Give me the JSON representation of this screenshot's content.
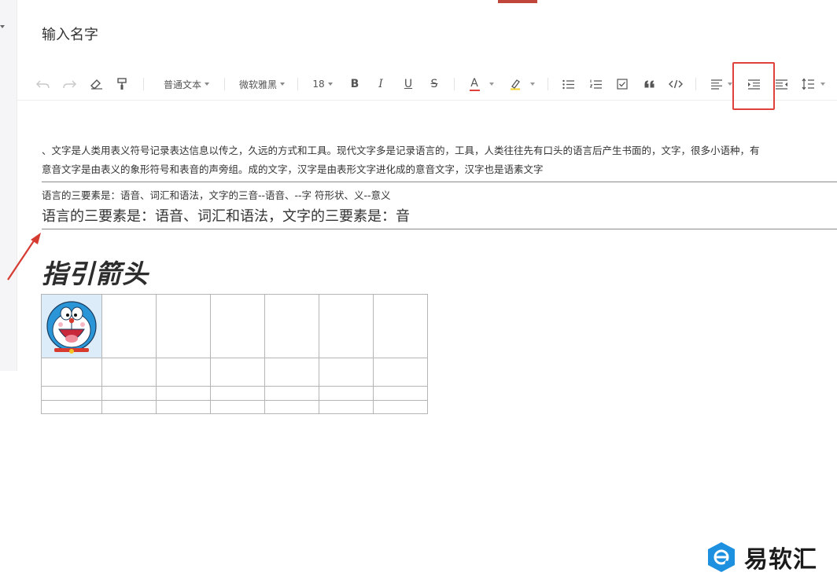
{
  "document": {
    "title": "输入名字"
  },
  "toolbar": {
    "paragraph_style": "普通文本",
    "font_family": "微软雅黑",
    "font_size": "18",
    "bold_label": "B",
    "italic_label": "I",
    "underline_label": "U",
    "strike_label": "S",
    "font_color_label": "A",
    "accent_color": "#e0413b"
  },
  "content": {
    "paragraph1_line1": "、文字是人类用表义符号记录表达信息以传之，久远的方式和工具。现代文字多是记录语言的，工具，人类往往先有口头的语言后产生书面的，文字，很多小语种，有",
    "paragraph1_line2": "意音文字是由表义的象形符号和表音的声旁组。成的文字，汉字是由表形文字进化成的意音文字，汉字也是语素文字",
    "paragraph2": "语言的三要素是：语音、词汇和语法，文字的三音--语音、--字  符形状、义--意义",
    "paragraph3": "语言的三要素是：语音、词汇和语法，文字的三要素是：音",
    "heading": "指引箭头"
  },
  "watermark": {
    "text": "易软汇",
    "color": "#1e90e0"
  }
}
